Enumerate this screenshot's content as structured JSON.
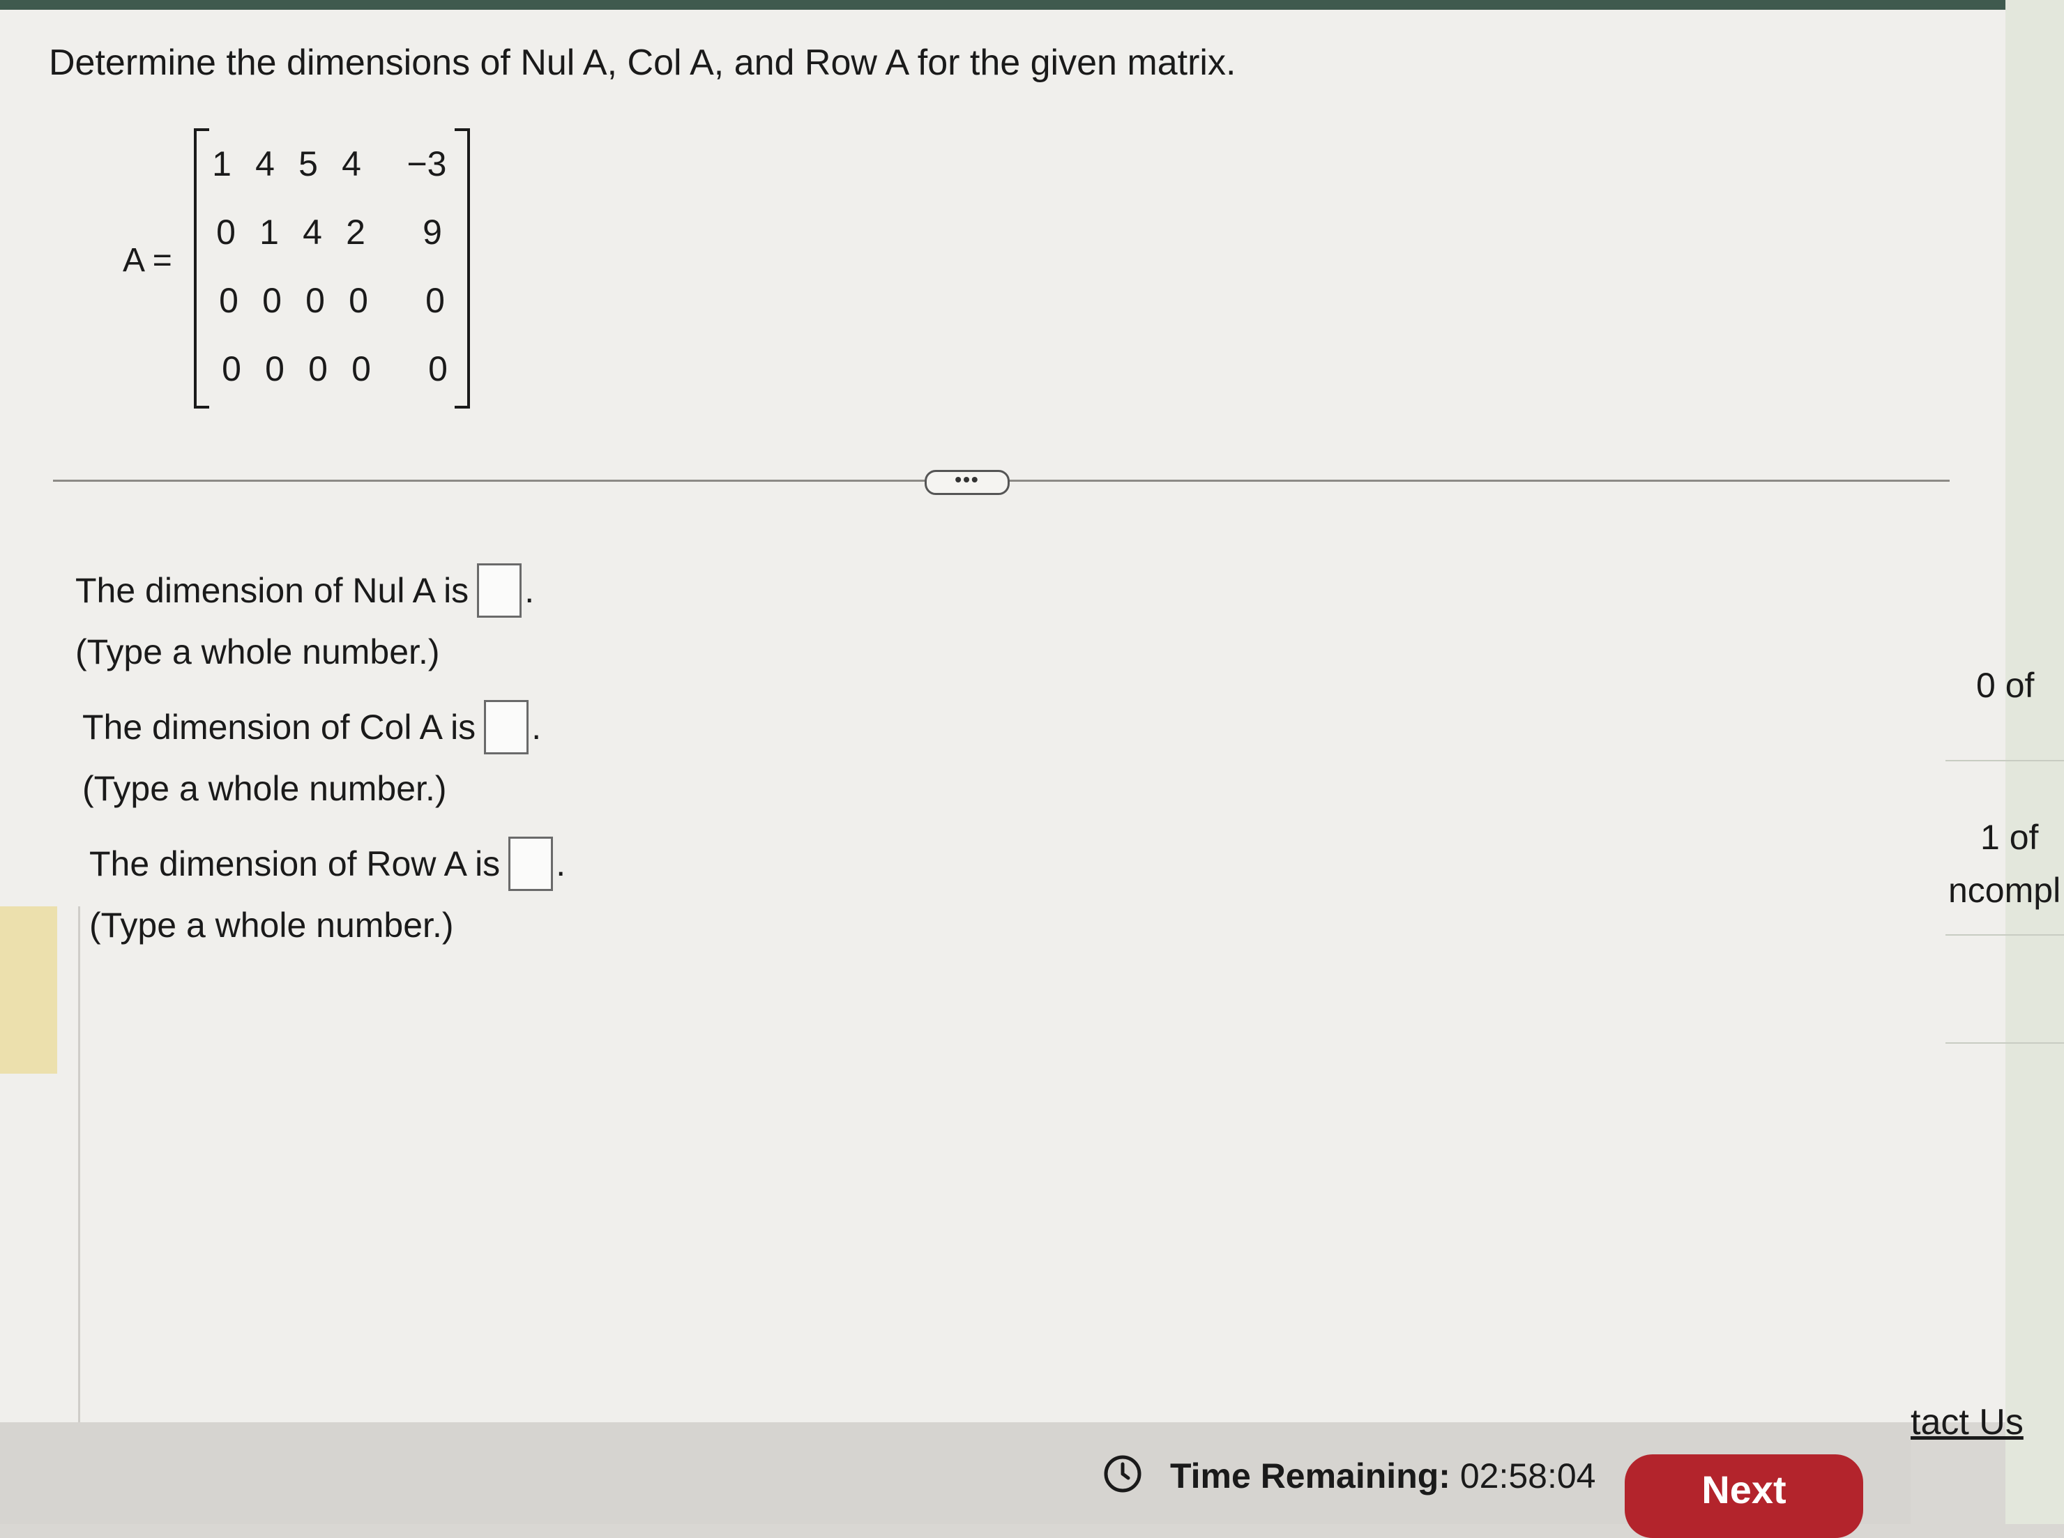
{
  "question": "Determine the dimensions of Nul A, Col A, and Row A for the given matrix.",
  "matrix": {
    "label": "A =",
    "rows": [
      [
        "1",
        "4",
        "5",
        "4",
        "−3"
      ],
      [
        "0",
        "1",
        "4",
        "2",
        "9"
      ],
      [
        "0",
        "0",
        "0",
        "0",
        "0"
      ],
      [
        "0",
        "0",
        "0",
        "0",
        "0"
      ]
    ]
  },
  "divider": {
    "more_label": "•••"
  },
  "answers": [
    {
      "prompt": "The dimension of Nul A is",
      "value": "",
      "period": ".",
      "hint": "(Type a whole number.)"
    },
    {
      "prompt": "The dimension of Col A is",
      "value": "",
      "period": ".",
      "hint": "(Type a whole number.)"
    },
    {
      "prompt": "The dimension of Row A is",
      "value": "",
      "period": ".",
      "hint": "(Type a whole number.)"
    }
  ],
  "side_panel": {
    "item1": "0 of",
    "item2": "1 of",
    "item2_status": "ncompl"
  },
  "footer": {
    "time_label": "Time Remaining:",
    "time_value": "02:58:04",
    "next_label": "Next",
    "contact_label": "tact Us"
  },
  "colors": {
    "next_button": "#b3242c",
    "top_strip": "#3f5a4e",
    "panel_background": "#f0efec"
  }
}
